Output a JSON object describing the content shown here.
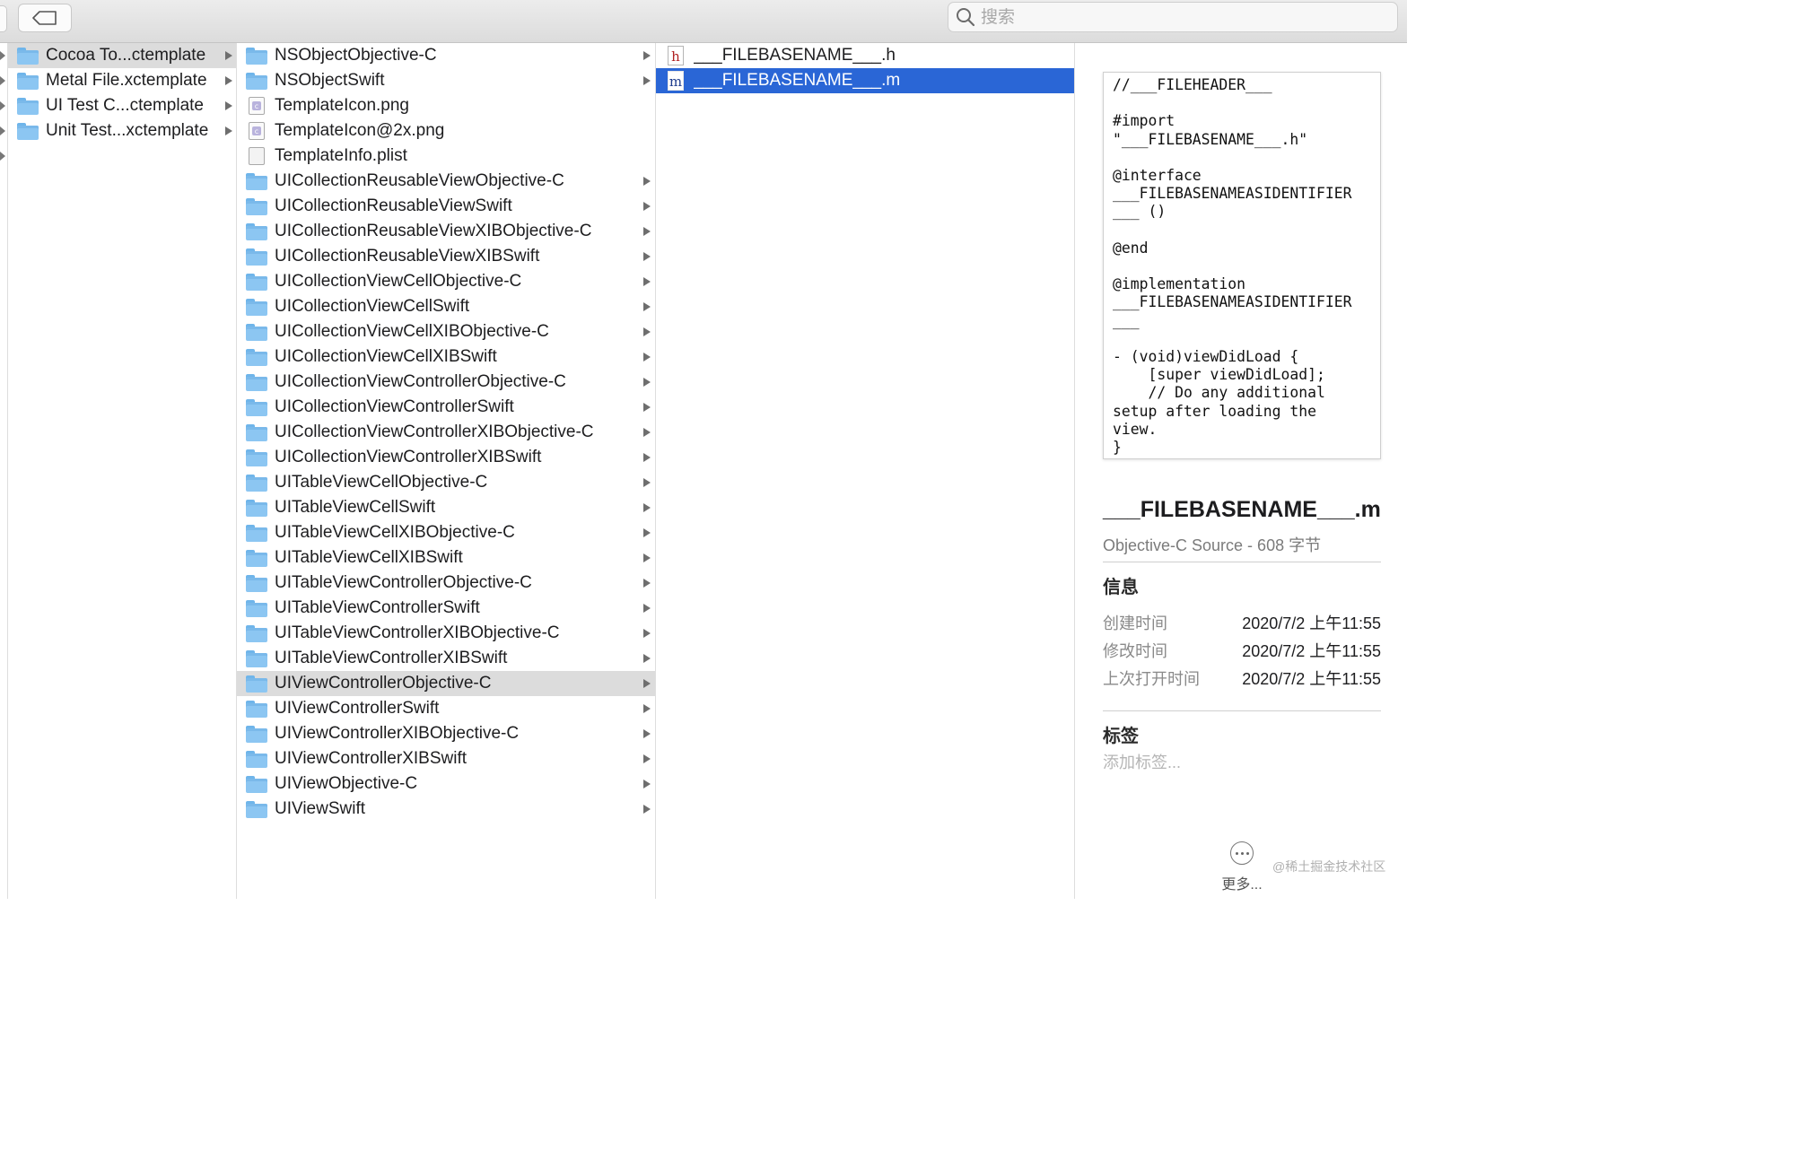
{
  "toolbar": {
    "back_icon": "tag-back-icon",
    "search_placeholder": "搜索",
    "search_icon": "search-icon"
  },
  "column_1": {
    "items": [
      {
        "label": "Cocoa To...ctemplate",
        "icon": "folder-icon",
        "selected": true
      },
      {
        "label": "Metal File.xctemplate",
        "icon": "folder-icon"
      },
      {
        "label": "UI Test C...ctemplate",
        "icon": "folder-icon"
      },
      {
        "label": "Unit Test...xctemplate",
        "icon": "folder-icon"
      }
    ]
  },
  "column_2": {
    "items": [
      {
        "label": "NSObjectObjective-C",
        "icon": "folder-icon",
        "has_children": true
      },
      {
        "label": "NSObjectSwift",
        "icon": "folder-icon",
        "has_children": true
      },
      {
        "label": "TemplateIcon.png",
        "icon": "image-file-icon",
        "has_children": false
      },
      {
        "label": "TemplateIcon@2x.png",
        "icon": "image-file-icon",
        "has_children": false
      },
      {
        "label": "TemplateInfo.plist",
        "icon": "plist-file-icon",
        "has_children": false
      },
      {
        "label": "UICollectionReusableViewObjective-C",
        "icon": "folder-icon",
        "has_children": true
      },
      {
        "label": "UICollectionReusableViewSwift",
        "icon": "folder-icon",
        "has_children": true
      },
      {
        "label": "UICollectionReusableViewXIBObjective-C",
        "icon": "folder-icon",
        "has_children": true
      },
      {
        "label": "UICollectionReusableViewXIBSwift",
        "icon": "folder-icon",
        "has_children": true
      },
      {
        "label": "UICollectionViewCellObjective-C",
        "icon": "folder-icon",
        "has_children": true
      },
      {
        "label": "UICollectionViewCellSwift",
        "icon": "folder-icon",
        "has_children": true
      },
      {
        "label": "UICollectionViewCellXIBObjective-C",
        "icon": "folder-icon",
        "has_children": true
      },
      {
        "label": "UICollectionViewCellXIBSwift",
        "icon": "folder-icon",
        "has_children": true
      },
      {
        "label": "UICollectionViewControllerObjective-C",
        "icon": "folder-icon",
        "has_children": true
      },
      {
        "label": "UICollectionViewControllerSwift",
        "icon": "folder-icon",
        "has_children": true
      },
      {
        "label": "UICollectionViewControllerXIBObjective-C",
        "icon": "folder-icon",
        "has_children": true
      },
      {
        "label": "UICollectionViewControllerXIBSwift",
        "icon": "folder-icon",
        "has_children": true
      },
      {
        "label": "UITableViewCellObjective-C",
        "icon": "folder-icon",
        "has_children": true
      },
      {
        "label": "UITableViewCellSwift",
        "icon": "folder-icon",
        "has_children": true
      },
      {
        "label": "UITableViewCellXIBObjective-C",
        "icon": "folder-icon",
        "has_children": true
      },
      {
        "label": "UITableViewCellXIBSwift",
        "icon": "folder-icon",
        "has_children": true
      },
      {
        "label": "UITableViewControllerObjective-C",
        "icon": "folder-icon",
        "has_children": true
      },
      {
        "label": "UITableViewControllerSwift",
        "icon": "folder-icon",
        "has_children": true
      },
      {
        "label": "UITableViewControllerXIBObjective-C",
        "icon": "folder-icon",
        "has_children": true
      },
      {
        "label": "UITableViewControllerXIBSwift",
        "icon": "folder-icon",
        "has_children": true
      },
      {
        "label": "UIViewControllerObjective-C",
        "icon": "folder-icon",
        "has_children": true,
        "selected": true
      },
      {
        "label": "UIViewControllerSwift",
        "icon": "folder-icon",
        "has_children": true
      },
      {
        "label": "UIViewControllerXIBObjective-C",
        "icon": "folder-icon",
        "has_children": true
      },
      {
        "label": "UIViewControllerXIBSwift",
        "icon": "folder-icon",
        "has_children": true
      },
      {
        "label": "UIViewObjective-C",
        "icon": "folder-icon",
        "has_children": true
      },
      {
        "label": "UIViewSwift",
        "icon": "folder-icon",
        "has_children": true
      }
    ]
  },
  "column_3": {
    "items": [
      {
        "label": "___FILEBASENAME___.h",
        "icon": "header-file-icon",
        "glyph": "h"
      },
      {
        "label": "___FILEBASENAME___.m",
        "icon": "objc-file-icon",
        "glyph": "m",
        "selected": true
      }
    ]
  },
  "preview": {
    "code": "//___FILEHEADER___\n\n#import\n\"___FILEBASENAME___.h\"\n\n@interface\n___FILEBASENAMEASIDENTIFIER\n___ ()\n\n@end\n\n@implementation\n___FILEBASENAMEASIDENTIFIER\n___\n\n- (void)viewDidLoad {\n    [super viewDidLoad];\n    // Do any additional\nsetup after loading the\nview.\n}",
    "file_name": "___FILEBASENAME___.m",
    "file_type": "Objective-C Source - 608 字节",
    "info_title": "信息",
    "info": [
      {
        "key": "创建时间",
        "value": "2020/7/2 上午11:55"
      },
      {
        "key": "修改时间",
        "value": "2020/7/2 上午11:55"
      },
      {
        "key": "上次打开时间",
        "value": "2020/7/2 上午11:55"
      }
    ],
    "tags_title": "标签",
    "tags_placeholder": "添加标签...",
    "more_label": "更多...",
    "watermark": "@稀土掘金技术社区"
  },
  "colors": {
    "selection_blue": "#2a66d6",
    "selection_grey": "#dcdcdc",
    "folder_blue": "#8cc6f2"
  }
}
